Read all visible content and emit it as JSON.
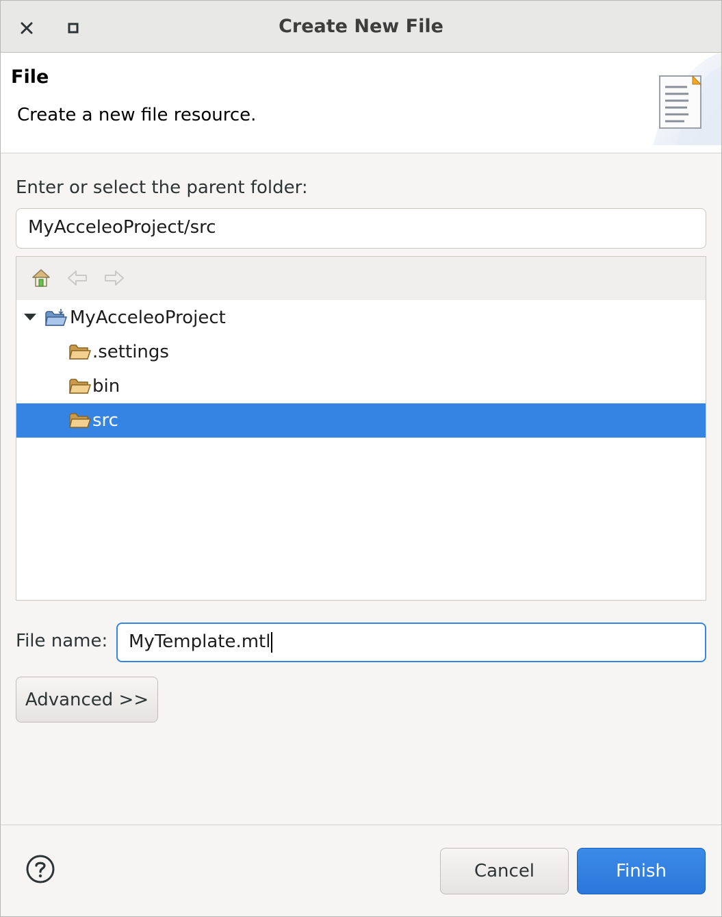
{
  "window": {
    "title": "Create New File"
  },
  "banner": {
    "title": "File",
    "description": "Create a new file resource."
  },
  "folder": {
    "label": "Enter or select the parent folder:",
    "value": "MyAcceleoProject/src"
  },
  "tree": {
    "toolbar": [
      "home-icon",
      "back-arrow-icon",
      "forward-arrow-icon"
    ],
    "root": {
      "label": "MyAcceleoProject",
      "icon": "project-folder-icon",
      "expanded": true
    },
    "children": [
      {
        "label": ".settings",
        "icon": "folder-icon",
        "selected": false
      },
      {
        "label": "bin",
        "icon": "folder-icon",
        "selected": false
      },
      {
        "label": "src",
        "icon": "folder-icon",
        "selected": true
      }
    ]
  },
  "filename": {
    "label": "File name:",
    "value": "MyTemplate.mtl"
  },
  "buttons": {
    "advanced": "Advanced >>",
    "cancel": "Cancel",
    "finish": "Finish"
  },
  "colors": {
    "accent": "#3584e4",
    "selection": "#3584e4",
    "folder": "#e9b96e"
  }
}
